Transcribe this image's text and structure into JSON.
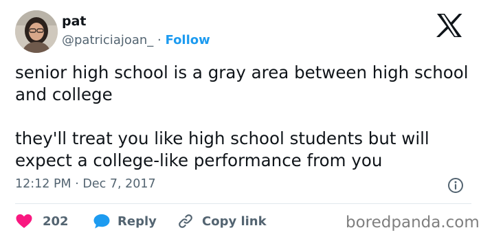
{
  "author": {
    "display_name": "pat",
    "handle": "@patriciajoan_",
    "separator": "·",
    "follow_label": "Follow"
  },
  "tweet": {
    "paragraphs": [
      "senior high school is a gray area between high school and college",
      "they'll treat you like high school students but will expect a college-like performance from you"
    ]
  },
  "meta": {
    "time": "12:12 PM",
    "separator": "·",
    "date": "Dec 7, 2017"
  },
  "actions": {
    "like_count": "202",
    "reply_label": "Reply",
    "copy_link_label": "Copy link"
  },
  "watermark": "boredpanda.com",
  "icons": {
    "brand": "x-logo-icon",
    "info": "info-icon",
    "like": "heart-icon",
    "reply": "speech-bubble-icon",
    "copy_link": "link-icon"
  },
  "colors": {
    "text": "#0f1419",
    "secondary": "#536471",
    "follow": "#1d9bf0",
    "like": "#f91880",
    "reply": "#1d9bf0",
    "divider": "#e1e8ed"
  }
}
